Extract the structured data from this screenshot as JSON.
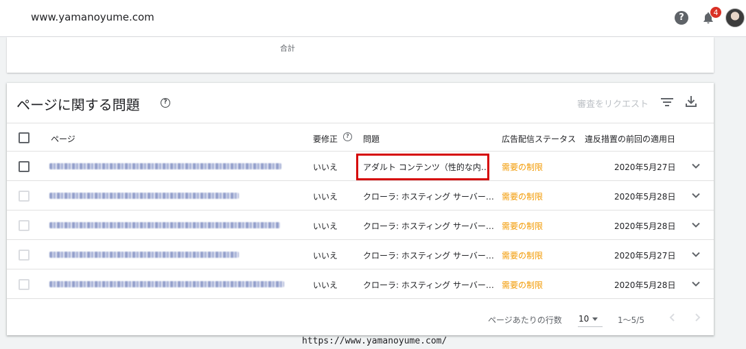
{
  "header": {
    "site_name": "www.yamanoyume.com",
    "help_icon": "help-circle-icon",
    "notification_count": "4",
    "notification_icon": "bell-icon"
  },
  "summary_card": {
    "total_label": "合計"
  },
  "issues_card": {
    "title": "ページに関する問題",
    "review_request_label": "審査をリクエスト",
    "columns": {
      "page": "ページ",
      "fix_required": "要修正",
      "issue": "問題",
      "ad_status": "広告配信ステータス",
      "last_applied": "違反措置の前回の適用日"
    },
    "rows": [
      {
        "fix": "いいえ",
        "issue": "アダルト コンテンツ（性的な内…",
        "status": "需要の制限",
        "date": "2020年5月27日"
      },
      {
        "fix": "いいえ",
        "issue": "クローラ: ホスティング サーバー…",
        "status": "需要の制限",
        "date": "2020年5月28日"
      },
      {
        "fix": "いいえ",
        "issue": "クローラ: ホスティング サーバー…",
        "status": "需要の制限",
        "date": "2020年5月28日"
      },
      {
        "fix": "いいえ",
        "issue": "クローラ: ホスティング サーバー…",
        "status": "需要の制限",
        "date": "2020年5月27日"
      },
      {
        "fix": "いいえ",
        "issue": "クローラ: ホスティング サーバー…",
        "status": "需要の制限",
        "date": "2020年5月28日"
      }
    ],
    "pagination": {
      "rows_per_page_label": "ページあたりの行数",
      "rows_per_page_value": "10",
      "range": "1〜5/5"
    }
  },
  "watermark": "https://www.yamanoyume.com/",
  "colors": {
    "status": "#f29900",
    "highlight": "#d50000",
    "badge": "#d93025"
  }
}
